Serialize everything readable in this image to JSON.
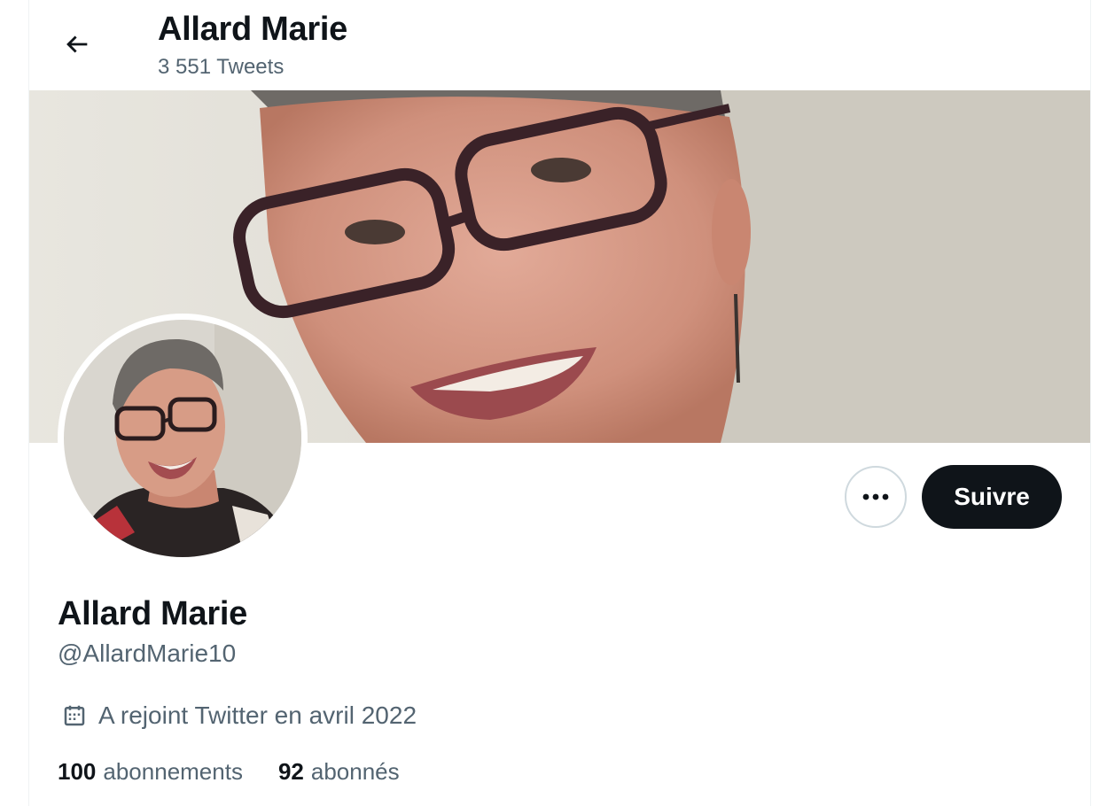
{
  "header": {
    "title": "Allard Marie",
    "tweet_count": "3 551 Tweets"
  },
  "profile": {
    "display_name": "Allard Marie",
    "handle": "@AllardMarie10",
    "joined": "A rejoint Twitter en avril 2022",
    "follow_label": "Suivre",
    "following_count": "100",
    "following_label": "abonnements",
    "followers_count": "92",
    "followers_label": "abonnés"
  },
  "icons": {
    "back": "arrow-left-icon",
    "more": "more-horizontal-icon",
    "calendar": "calendar-icon"
  },
  "colors": {
    "text_primary": "#0f1419",
    "text_secondary": "#536471",
    "follow_button_bg": "#0f1419",
    "border": "#cfd9de"
  }
}
